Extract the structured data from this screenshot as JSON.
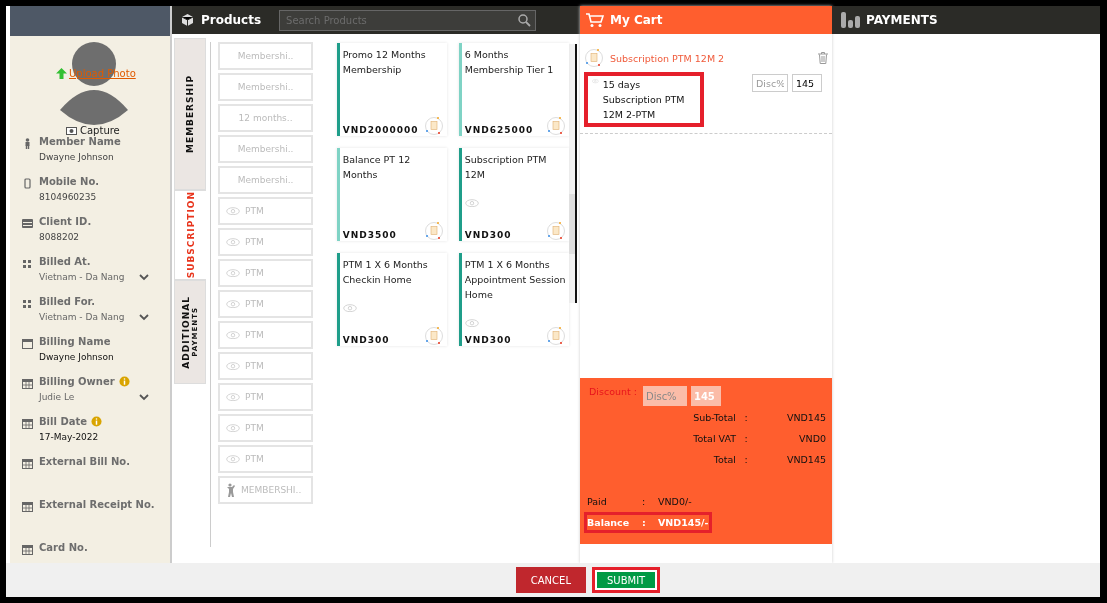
{
  "member": {
    "upload_link": "Upload Photo",
    "capture_label": "Capture",
    "fields": [
      {
        "kind": "text",
        "label": "Member Name",
        "value": "Dwayne Johnson",
        "info": false
      },
      {
        "kind": "text",
        "label": "Mobile No.",
        "value": "8104960235",
        "info": false
      },
      {
        "kind": "text",
        "label": "Client ID.",
        "value": "8088202",
        "info": false
      },
      {
        "kind": "select",
        "label": "Billed At.",
        "value": "Vietnam - Da Nang",
        "info": false
      },
      {
        "kind": "select",
        "label": "Billed For.",
        "value": "Vietnam - Da Nang",
        "info": false
      },
      {
        "kind": "text",
        "label": "Billing Name",
        "value": "Dwayne  Johnson",
        "info": false
      },
      {
        "kind": "select",
        "label": "Billing Owner",
        "value": "Judie Le",
        "info": true
      },
      {
        "kind": "text",
        "label": "Bill Date",
        "value": "17-May-2022",
        "info": true
      },
      {
        "kind": "empty",
        "label": "External Bill No.",
        "info": false
      },
      {
        "kind": "empty",
        "label": "External Receipt No.",
        "info": false
      },
      {
        "kind": "empty",
        "label": "Card No.",
        "info": false
      }
    ]
  },
  "products": {
    "title": "Products",
    "search": {
      "placeholder": "Search Products"
    },
    "tabs": [
      {
        "lines": [
          "MEMBERSHIP"
        ],
        "selected": false
      },
      {
        "lines": [
          "SUBSCRIPTION"
        ],
        "selected": true
      },
      {
        "lines": [
          "ADDITIONAL",
          "PAYMENTS"
        ],
        "selected": false
      }
    ],
    "categories": [
      {
        "kind": "text",
        "label": "Membershi.."
      },
      {
        "kind": "text",
        "label": "Membershi.."
      },
      {
        "kind": "text",
        "label": "12 months.."
      },
      {
        "kind": "text",
        "label": "Membershi.."
      },
      {
        "kind": "text",
        "label": "Membershi.."
      },
      {
        "kind": "eye",
        "label": "PTM"
      },
      {
        "kind": "eye",
        "label": "PTM"
      },
      {
        "kind": "eye",
        "label": "PTM"
      },
      {
        "kind": "eye",
        "label": "PTM"
      },
      {
        "kind": "eye",
        "label": "PTM"
      },
      {
        "kind": "eye",
        "label": "PTM"
      },
      {
        "kind": "eye",
        "label": "PTM"
      },
      {
        "kind": "eye",
        "label": "PTM"
      },
      {
        "kind": "eye",
        "label": "PTM"
      },
      {
        "kind": "figure",
        "label": "MEMBERSHI.."
      }
    ],
    "cards": [
      {
        "name": "Promo 12 Months Membership",
        "price": "VND2000000",
        "eye": false,
        "color": "#1f9e8a"
      },
      {
        "name": "6 Months Membership Tier 1",
        "price": "VND625000",
        "eye": false,
        "color": "#7fd3c5"
      },
      {
        "name": "Balance PT 12 Months",
        "price": "VND3500",
        "eye": false,
        "color": "#7fd3c5"
      },
      {
        "name": "Subscription PTM 12M",
        "price": "VND300",
        "eye": true,
        "color": "#1f9e8a"
      },
      {
        "name": "PTM 1 X 6 Months Checkin Home",
        "price": "VND300",
        "eye": true,
        "color": "#1f9e8a"
      },
      {
        "name": "PTM 1 X 6 Months Appointment Session Home",
        "price": "VND300",
        "eye": true,
        "color": "#1f9e8a"
      }
    ]
  },
  "cart": {
    "title": "My Cart",
    "items": [
      {
        "name": "Subscription PTM 12M 2",
        "detail": "15 days Subscription PTM 12M 2-PTM",
        "highlighted": true,
        "discount": {
          "placeholder": "Disc%"
        },
        "amount": "145"
      }
    ],
    "discount": {
      "label": "Discount :",
      "placeholder": "Disc%",
      "value": "145"
    },
    "totals": [
      {
        "label": "Sub-Total",
        "separator": ":",
        "value": "VND145"
      },
      {
        "label": "Total VAT",
        "separator": ":",
        "value": "VND0"
      },
      {
        "label": "Total",
        "separator": ":",
        "value": "VND145"
      }
    ],
    "paid": {
      "label": "Paid",
      "separator": ":",
      "value": "VND0/-",
      "highlighted": false
    },
    "balance": {
      "label": "Balance",
      "separator": ":",
      "value": "VND145/-",
      "highlighted": true
    }
  },
  "payments": {
    "title": "PAYMENTS"
  },
  "buttons": [
    {
      "kind": "cancel",
      "label": "CANCEL",
      "highlighted": false
    },
    {
      "kind": "submit",
      "label": "SUBMIT",
      "highlighted": true
    }
  ]
}
